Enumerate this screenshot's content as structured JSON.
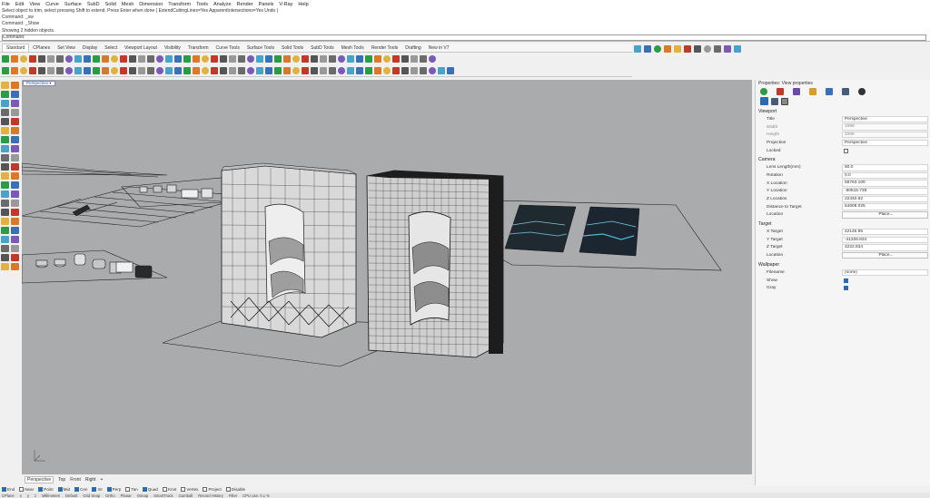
{
  "menu": [
    "File",
    "Edit",
    "View",
    "Curve",
    "Surface",
    "SubD",
    "Solid",
    "Mesh",
    "Dimension",
    "Transform",
    "Tools",
    "Analyze",
    "Render",
    "Panels",
    "V-Ray",
    "Help"
  ],
  "command_history": [
    "Select object to trim, select pressing Shift to extend. Press Enter when done ( ExtendCuttingLines=Yes  ApparentIntersections=Yes  Undo )",
    "Command: _sw",
    "Command: _Show",
    "Showing 2 hidden objects."
  ],
  "command_prompt": "Command:",
  "toolbar_tabs": [
    "Standard",
    "CPlanes",
    "Set View",
    "Display",
    "Select",
    "Viewport Layout",
    "Visibility",
    "Transform",
    "Curve Tools",
    "Surface Tools",
    "Solid Tools",
    "SubD Tools",
    "Mesh Tools",
    "Render Tools",
    "Drafting",
    "New in V7"
  ],
  "active_tab": "Standard",
  "viewport": {
    "label": "Perspective",
    "bottom_tabs": [
      "Perspective",
      "Top",
      "Front",
      "Right"
    ],
    "add_tab": "+"
  },
  "osnaps": [
    {
      "label": "End",
      "on": true
    },
    {
      "label": "Near",
      "on": false
    },
    {
      "label": "Point",
      "on": true
    },
    {
      "label": "Mid",
      "on": true
    },
    {
      "label": "Cen",
      "on": true
    },
    {
      "label": "Int",
      "on": true
    },
    {
      "label": "Perp",
      "on": true
    },
    {
      "label": "Tan",
      "on": false
    },
    {
      "label": "Quad",
      "on": true
    },
    {
      "label": "Knot",
      "on": false
    },
    {
      "label": "Vertex",
      "on": false
    }
  ],
  "osnap_extra": [
    "Project",
    "Disable"
  ],
  "status_bar": [
    "CPlane",
    "x",
    "y",
    "z",
    "Millimeters",
    "Default",
    "Grid Snap",
    "Ortho",
    "Planar",
    "Osnap",
    "SmartTrack",
    "Gumball",
    "Record History",
    "Filter",
    "CPU use: 0.1 %"
  ],
  "properties": {
    "title": "Properties: View properties",
    "viewport_section": "Viewport",
    "viewport_rows": [
      {
        "k": "Title",
        "v": "Perspective",
        "dim": false
      },
      {
        "k": "Width",
        "v": "1899",
        "dim": true
      },
      {
        "k": "Height",
        "v": "1006",
        "dim": true
      },
      {
        "k": "Projection",
        "v": "Perspective",
        "dim": false
      },
      {
        "k": "Locked",
        "v": "",
        "dim": false,
        "check": false
      }
    ],
    "camera_section": "Camera",
    "camera_rows": [
      {
        "k": "Lens Length(mm)",
        "v": "50.0"
      },
      {
        "k": "Rotation",
        "v": "0.0"
      },
      {
        "k": "X Location",
        "v": "56763.109"
      },
      {
        "k": "Y Location",
        "v": "-90615.738"
      },
      {
        "k": "Z Location",
        "v": "22440.92"
      },
      {
        "k": "Distance to Target",
        "v": "54609.025"
      },
      {
        "k": "Location",
        "v": "Place...",
        "btn": true
      }
    ],
    "target_section": "Target",
    "target_rows": [
      {
        "k": "X Target",
        "v": "42145.95"
      },
      {
        "k": "Y Target",
        "v": "-41206.834"
      },
      {
        "k": "Z Target",
        "v": "4222.834"
      },
      {
        "k": "Location",
        "v": "Place...",
        "btn": true
      }
    ],
    "wallpaper_section": "Wallpaper",
    "wallpaper_rows": [
      {
        "k": "Filename",
        "v": "(none)"
      },
      {
        "k": "Show",
        "check": true
      },
      {
        "k": "Gray",
        "check": true
      }
    ]
  },
  "colors": {
    "viewport_bg": "#a9abac",
    "accent": "#2b6bb4",
    "wireframe": "#1a1a1a"
  }
}
